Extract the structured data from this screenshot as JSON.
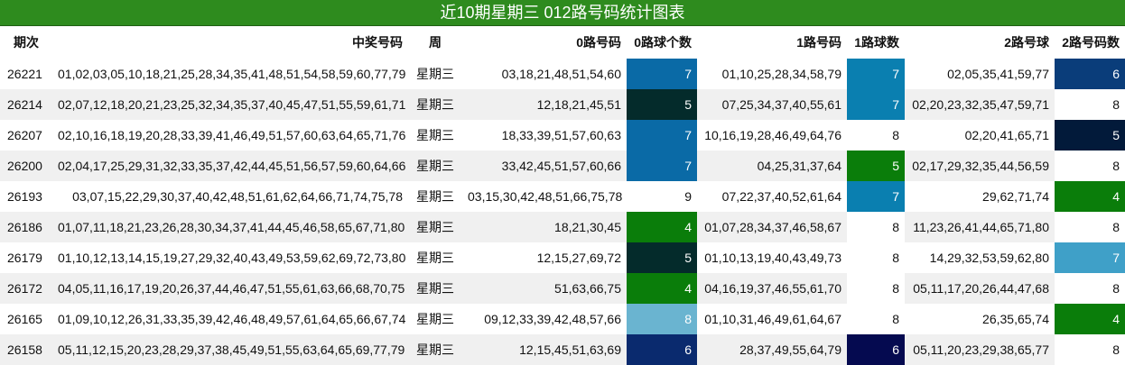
{
  "title": "近10期星期三 012路号码统计图表",
  "headers": [
    "期次",
    "中奖号码",
    "周",
    "0路号码",
    "0路球个数",
    "1路号码",
    "1路球数",
    "2路号球",
    "2路号码数"
  ],
  "rows": [
    {
      "issue": "26221",
      "numbers": "01,02,03,05,10,18,21,25,28,34,35,41,48,51,54,58,59,60,77,79",
      "week": "星期三",
      "r0": "03,18,21,48,51,54,60",
      "c0": "7",
      "r1": "01,10,25,28,34,58,79",
      "c1": "7",
      "r2": "02,05,35,41,59,77",
      "c2": "6",
      "bg0": "#0a6aa6",
      "fg0": "#ffffff",
      "bg1": "#0a7fb0",
      "fg1": "#ffffff",
      "bg2": "#0a3d7a",
      "fg2": "#ffffff"
    },
    {
      "issue": "26214",
      "numbers": "02,07,12,18,20,21,23,25,32,34,35,37,40,45,47,51,55,59,61,71",
      "week": "星期三",
      "r0": "12,18,21,45,51",
      "c0": "5",
      "r1": "07,25,34,37,40,55,61",
      "c1": "7",
      "r2": "02,20,23,32,35,47,59,71",
      "c2": "8",
      "bg0": "#042b2b",
      "fg0": "#ffffff",
      "bg1": "#0a7fb0",
      "fg1": "#ffffff",
      "bg2": "#ffffff",
      "fg2": "#111111"
    },
    {
      "issue": "26207",
      "numbers": "02,10,16,18,19,20,28,33,39,41,46,49,51,57,60,63,64,65,71,76",
      "week": "星期三",
      "r0": "18,33,39,51,57,60,63",
      "c0": "7",
      "r1": "10,16,19,28,46,49,64,76",
      "c1": "8",
      "r2": "02,20,41,65,71",
      "c2": "5",
      "bg0": "#0a6aa6",
      "fg0": "#ffffff",
      "bg1": "#ffffff",
      "fg1": "#111111",
      "bg2": "#021a3a",
      "fg2": "#ffffff"
    },
    {
      "issue": "26200",
      "numbers": "02,04,17,25,29,31,32,33,35,37,42,44,45,51,56,57,59,60,64,66",
      "week": "星期三",
      "r0": "33,42,45,51,57,60,66",
      "c0": "7",
      "r1": "04,25,31,37,64",
      "c1": "5",
      "r2": "02,17,29,32,35,44,56,59",
      "c2": "8",
      "bg0": "#0a6aa6",
      "fg0": "#ffffff",
      "bg1": "#0a7d0a",
      "fg1": "#ffffff",
      "bg2": "#ffffff",
      "fg2": "#111111"
    },
    {
      "issue": "26193",
      "numbers": "03,07,15,22,29,30,37,40,42,48,51,61,62,64,66,71,74,75,78",
      "week": "星期三",
      "r0": "03,15,30,42,48,51,66,75,78",
      "c0": "9",
      "r1": "07,22,37,40,52,61,64",
      "c1": "7",
      "r2": "29,62,71,74",
      "c2": "4",
      "bg0": "#ffffff",
      "fg0": "#111111",
      "bg1": "#0a7fb0",
      "fg1": "#ffffff",
      "bg2": "#0a7d0a",
      "fg2": "#ffffff"
    },
    {
      "issue": "26186",
      "numbers": "01,07,11,18,21,23,26,28,30,34,37,41,44,45,46,58,65,67,71,80",
      "week": "星期三",
      "r0": "18,21,30,45",
      "c0": "4",
      "r1": "01,07,28,34,37,46,58,67",
      "c1": "8",
      "r2": "11,23,26,41,44,65,71,80",
      "c2": "8",
      "bg0": "#0a7d0a",
      "fg0": "#ffffff",
      "bg1": "#ffffff",
      "fg1": "#111111",
      "bg2": "#ffffff",
      "fg2": "#111111"
    },
    {
      "issue": "26179",
      "numbers": "01,10,12,13,14,15,19,27,29,32,40,43,49,53,59,62,69,72,73,80",
      "week": "星期三",
      "r0": "12,15,27,69,72",
      "c0": "5",
      "r1": "01,10,13,19,40,43,49,73",
      "c1": "8",
      "r2": "14,29,32,53,59,62,80",
      "c2": "7",
      "bg0": "#042b2b",
      "fg0": "#ffffff",
      "bg1": "#ffffff",
      "fg1": "#111111",
      "bg2": "#3fa0c8",
      "fg2": "#ffffff"
    },
    {
      "issue": "26172",
      "numbers": "04,05,11,16,17,19,20,26,37,44,46,47,51,55,61,63,66,68,70,75",
      "week": "星期三",
      "r0": "51,63,66,75",
      "c0": "4",
      "r1": "04,16,19,37,46,55,61,70",
      "c1": "8",
      "r2": "05,11,17,20,26,44,47,68",
      "c2": "8",
      "bg0": "#0a7d0a",
      "fg0": "#ffffff",
      "bg1": "#ffffff",
      "fg1": "#111111",
      "bg2": "#ffffff",
      "fg2": "#111111"
    },
    {
      "issue": "26165",
      "numbers": "01,09,10,12,26,31,33,35,39,42,46,48,49,57,61,64,65,66,67,74",
      "week": "星期三",
      "r0": "09,12,33,39,42,48,57,66",
      "c0": "8",
      "r1": "01,10,31,46,49,61,64,67",
      "c1": "8",
      "r2": "26,35,65,74",
      "c2": "4",
      "bg0": "#6ab4d0",
      "fg0": "#ffffff",
      "bg1": "#ffffff",
      "fg1": "#111111",
      "bg2": "#0a7d0a",
      "fg2": "#ffffff"
    },
    {
      "issue": "26158",
      "numbers": "05,11,12,15,20,23,28,29,37,38,45,49,51,55,63,64,65,69,77,79",
      "week": "星期三",
      "r0": "12,15,45,51,63,69",
      "c0": "6",
      "r1": "28,37,49,55,64,79",
      "c1": "6",
      "r2": "05,11,20,23,29,38,65,77",
      "c2": "8",
      "bg0": "#0a2a6e",
      "fg0": "#ffffff",
      "bg1": "#050a50",
      "fg1": "#ffffff",
      "bg2": "#ffffff",
      "fg2": "#111111"
    }
  ]
}
